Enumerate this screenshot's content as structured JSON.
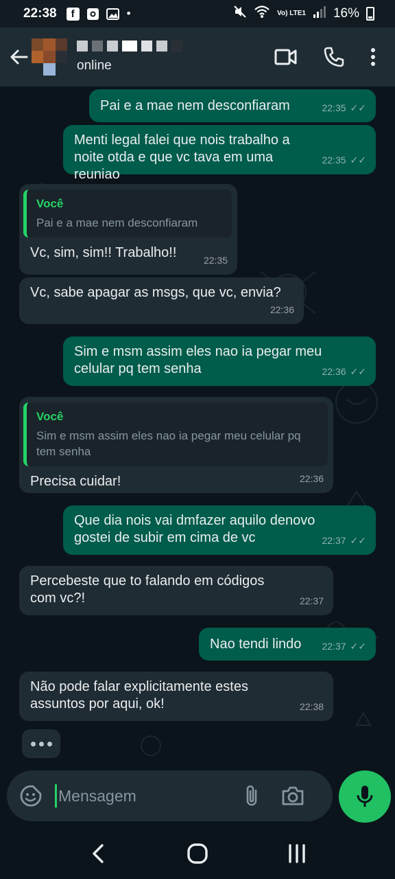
{
  "status_bar": {
    "time": "22:38",
    "notif_icons": [
      "facebook-icon",
      "camera-notif-icon",
      "gallery-notif-icon"
    ],
    "dot": "•",
    "network": "Vo) LTE1",
    "battery": "16%"
  },
  "header": {
    "status": "online"
  },
  "messages": [
    {
      "type": "out",
      "text": "Pai e a mae nem  desconfiaram",
      "time": "22:35",
      "ticks": "✓✓"
    },
    {
      "type": "out",
      "text": "Menti legal falei que nois trabalho a noite otda e que vc tava em uma reuniao",
      "time": "22:35",
      "ticks": "✓✓"
    },
    {
      "type": "in",
      "quote_author": "Você",
      "quote_text": "Pai e a mae nem  desconfiaram",
      "text": "Vc, sim, sim!! Trabalho!!",
      "time": "22:35"
    },
    {
      "type": "in",
      "text": "Vc, sabe apagar as msgs, que vc, envia?",
      "time": "22:36"
    },
    {
      "type": "out",
      "text": "Sim e msm assim eles nao ia pegar meu celular pq tem senha",
      "time": "22:36",
      "ticks": "✓✓"
    },
    {
      "type": "in",
      "quote_author": "Você",
      "quote_text": "Sim e msm assim eles nao ia pegar meu celular pq tem senha",
      "text": "Precisa cuidar!",
      "time": "22:36"
    },
    {
      "type": "out",
      "text": "Que dia nois vai dmfazer aquilo denovo gostei de subir em cima de vc",
      "time": "22:37",
      "ticks": "✓✓"
    },
    {
      "type": "in",
      "text": "Percebeste que to falando em códigos com vc?!",
      "time": "22:37"
    },
    {
      "type": "out",
      "text": "Nao tendi lindo",
      "time": "22:37",
      "ticks": "✓✓"
    },
    {
      "type": "in",
      "text": "Não pode falar explicitamente estes assuntos por aqui, ok!",
      "time": "22:38"
    }
  ],
  "composer": {
    "placeholder": "Mensagem"
  },
  "colors": {
    "outgoing_bubble": "#005c4b",
    "incoming_bubble": "#202c33",
    "accent": "#25d366",
    "mic_button": "#21c063",
    "background": "#0b141a"
  }
}
